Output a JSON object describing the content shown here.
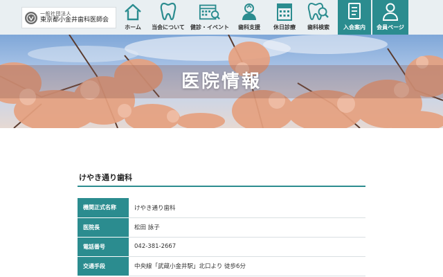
{
  "header": {
    "logo": {
      "sub": "一般社団法人",
      "main": "東京都小金井歯科医師会"
    },
    "nav": [
      {
        "label": "ホーム",
        "icon": "home-icon"
      },
      {
        "label": "当会について",
        "icon": "tooth-icon"
      },
      {
        "label": "健診・イベント",
        "icon": "calendar-search-icon"
      },
      {
        "label": "歯科支援",
        "icon": "support-icon"
      },
      {
        "label": "休日診療",
        "icon": "holiday-calendar-icon"
      },
      {
        "label": "歯科検索",
        "icon": "tooth-search-icon"
      },
      {
        "label": "入会案内",
        "icon": "document-icon"
      },
      {
        "label": "会員ページ",
        "icon": "member-icon"
      }
    ]
  },
  "hero": {
    "title": "医院情報"
  },
  "clinic": {
    "name": "けやき通り歯科",
    "rows": [
      {
        "label": "機関正式名称",
        "value": "けやき通り歯科"
      },
      {
        "label": "医院長",
        "value": "松田 詠子"
      },
      {
        "label": "電話番号",
        "value": "042-381-2667"
      },
      {
        "label": "交通手段",
        "value": "中央線「武蔵小金井駅」北口より 徒歩6分"
      }
    ]
  },
  "colors": {
    "accent": "#2b8c8f",
    "header_bg": "#e9eff2"
  }
}
